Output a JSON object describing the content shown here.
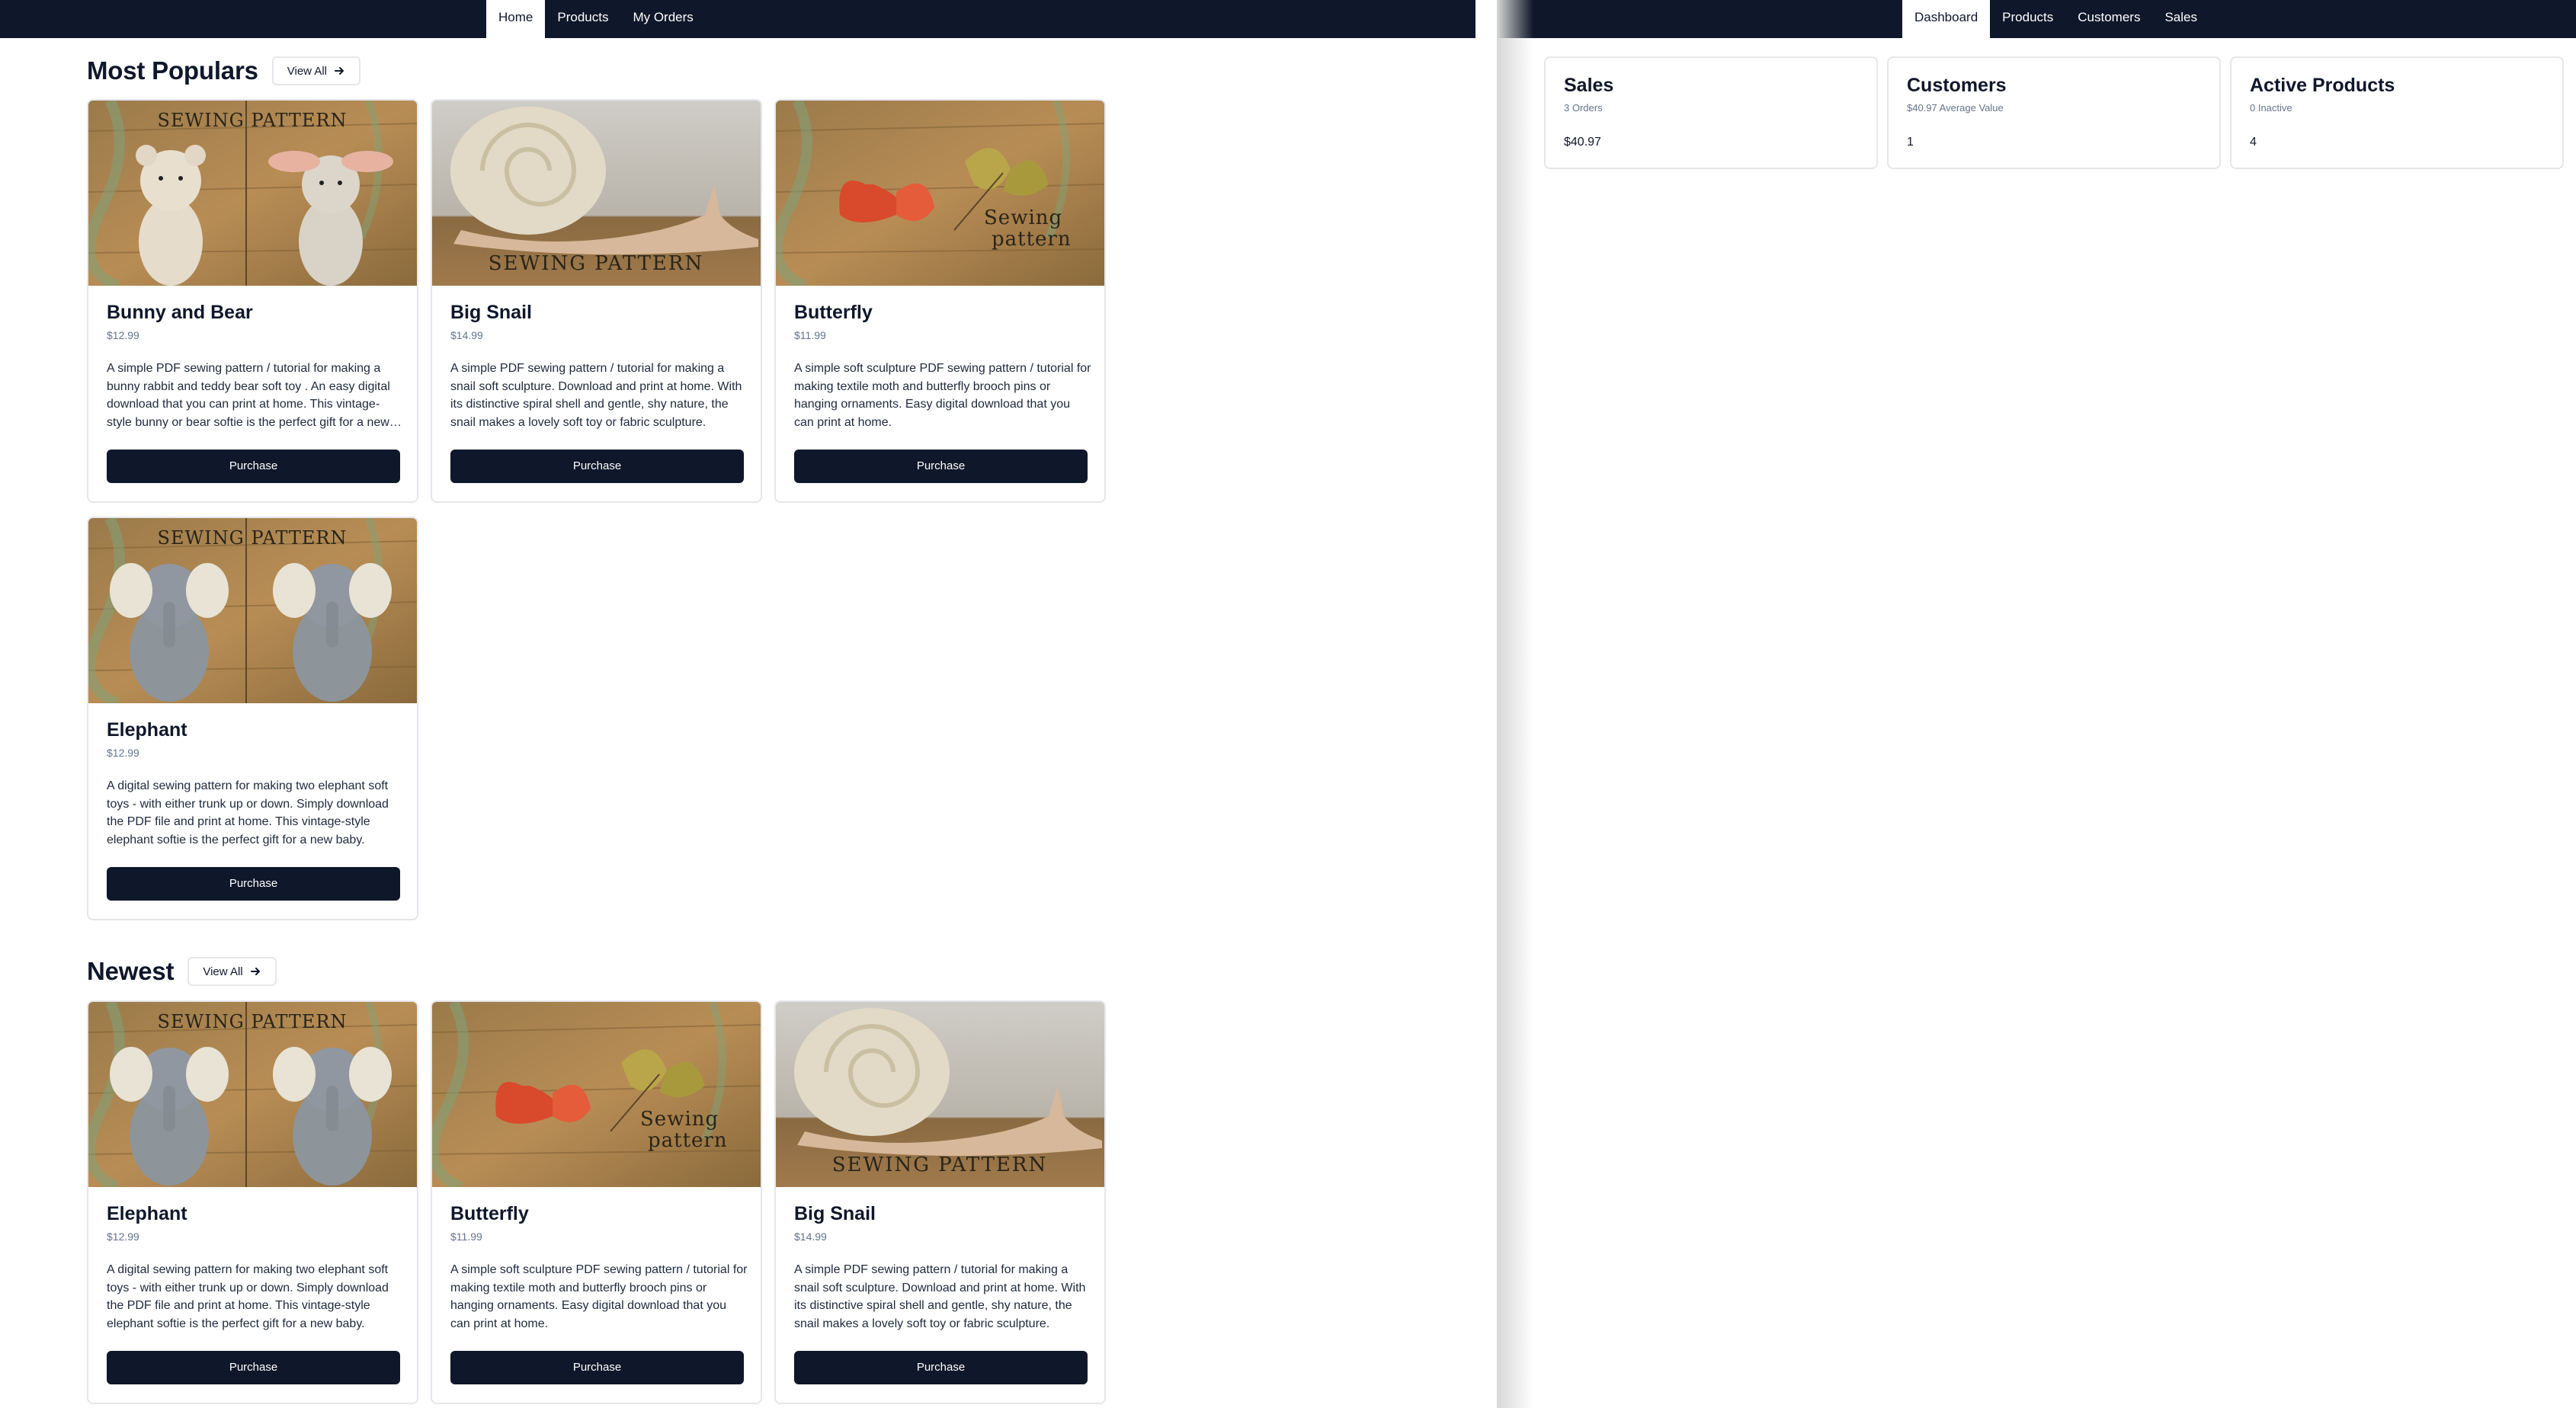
{
  "store": {
    "nav": {
      "tabs": [
        {
          "label": "Home"
        },
        {
          "label": "Products"
        },
        {
          "label": "My Orders"
        }
      ]
    },
    "sections": [
      {
        "title": "Most Populars",
        "view_all": "View All",
        "products": [
          {
            "name": "Bunny and Bear",
            "price": "$12.99",
            "image_text": "SEWING PATTERN",
            "image": "bunny-bear-image",
            "description": "A simple PDF sewing pattern / tutorial for making a bunny rabbit and teddy bear soft toy . An easy digital download that you can print at home. This vintage-style bunny or bear softie is the perfect gift for a new baby.",
            "button": "Purchase"
          },
          {
            "name": "Big Snail",
            "price": "$14.99",
            "image_text": "SEWING PATTERN",
            "image": "snail-image",
            "description": "A simple PDF sewing pattern / tutorial for making a snail soft sculpture. Download and print at home. With its distinctive spiral shell and gentle, shy nature, the snail makes a lovely soft toy or fabric sculpture.",
            "button": "Purchase"
          },
          {
            "name": "Butterfly",
            "price": "$11.99",
            "image_text": "Sewing pattern",
            "image": "butterfly-image",
            "description": "A simple soft sculpture PDF sewing pattern / tutorial for making textile moth and butterfly brooch pins or hanging ornaments. Easy digital download that you can print at home.",
            "button": "Purchase"
          },
          {
            "name": "Elephant",
            "price": "$12.99",
            "image_text": "SEWING PATTERN",
            "image": "elephant-image",
            "description": "A digital sewing pattern for making two elephant soft toys - with either trunk up or down. Simply download the PDF file and print at home. This vintage-style elephant softie is the perfect gift for a new baby.",
            "button": "Purchase"
          }
        ]
      },
      {
        "title": "Newest",
        "view_all": "View All",
        "products": [
          {
            "name": "Elephant",
            "price": "$12.99",
            "image_text": "SEWING PATTERN",
            "image": "elephant-image",
            "description": "A digital sewing pattern for making two elephant soft toys - with either trunk up or down. Simply download the PDF file and print at home. This vintage-style elephant softie is the perfect gift for a new baby.",
            "button": "Purchase"
          },
          {
            "name": "Butterfly",
            "price": "$11.99",
            "image_text": "Sewing pattern",
            "image": "butterfly-image",
            "description": "A simple soft sculpture PDF sewing pattern / tutorial for making textile moth and butterfly brooch pins or hanging ornaments. Easy digital download that you can print at home.",
            "button": "Purchase"
          },
          {
            "name": "Big Snail",
            "price": "$14.99",
            "image_text": "SEWING PATTERN",
            "image": "snail-image",
            "description": "A simple PDF sewing pattern / tutorial for making a snail soft sculpture. Download and print at home. With its distinctive spiral shell and gentle, shy nature, the snail makes a lovely soft toy or fabric sculpture.",
            "button": "Purchase"
          }
        ]
      }
    ]
  },
  "admin": {
    "nav": {
      "tabs": [
        {
          "label": "Dashboard"
        },
        {
          "label": "Products"
        },
        {
          "label": "Customers"
        },
        {
          "label": "Sales"
        }
      ]
    },
    "stats": [
      {
        "title": "Sales",
        "subtitle": "3 Orders",
        "value": "$40.97"
      },
      {
        "title": "Customers",
        "subtitle": "$40.97 Average Value",
        "value": "1"
      },
      {
        "title": "Active Products",
        "subtitle": "0 Inactive",
        "value": "4"
      }
    ]
  },
  "colors": {
    "nav_bg": "#0f172a",
    "button_bg": "#0f172a",
    "muted_text": "#64748b",
    "border": "#e5e7eb"
  },
  "icons": {
    "view_all_arrow": "arrow-right-icon"
  }
}
